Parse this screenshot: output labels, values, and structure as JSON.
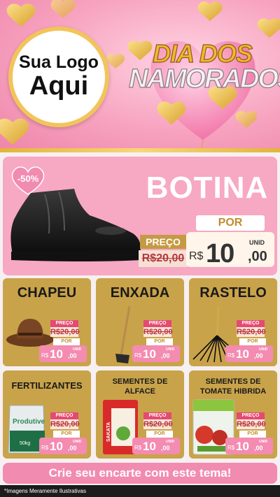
{
  "header": {
    "logo_line1": "Sua Logo",
    "logo_line2": "Aqui",
    "title_line1": "DIA DOS",
    "title_line2": "NAMORADOS",
    "colors": {
      "pink": "#f7a3c0",
      "gold": "#f0b82f"
    }
  },
  "hero": {
    "discount": "-50%",
    "name": "BOTINA",
    "preco_label": "PREÇO",
    "old_price": "R$20,00",
    "por_label": "POR",
    "currency": "R$",
    "price_int": "10",
    "price_dec": ",00",
    "unit": "UNID"
  },
  "products": [
    {
      "name": "CHAPEU",
      "icon": "cowboy-hat-icon",
      "preco_label": "PREÇO",
      "old_price": "R$20,00",
      "por_label": "POR",
      "currency": "R$",
      "price_int": "10",
      "price_dec": ",00",
      "unit": "UNID"
    },
    {
      "name": "ENXADA",
      "icon": "hoe-icon",
      "preco_label": "PREÇO",
      "old_price": "R$20,00",
      "por_label": "POR",
      "currency": "R$",
      "price_int": "10",
      "price_dec": ",00",
      "unit": "UNID"
    },
    {
      "name": "RASTELO",
      "icon": "rake-icon",
      "preco_label": "PREÇO",
      "old_price": "R$20,00",
      "por_label": "POR",
      "currency": "R$",
      "price_int": "10",
      "price_dec": ",00",
      "unit": "UNID"
    },
    {
      "name": "FERTILIZANTES",
      "icon": "fertilizer-bag-icon",
      "preco_label": "PREÇO",
      "old_price": "R$20,00",
      "por_label": "POR",
      "currency": "R$",
      "price_int": "10",
      "price_dec": ",00",
      "unit": "UNID"
    },
    {
      "name": "SEMENTES DE ALFACE",
      "icon": "seed-packet-icon",
      "preco_label": "PREÇO",
      "old_price": "R$20,00",
      "por_label": "POR",
      "currency": "R$",
      "price_int": "10",
      "price_dec": ",00",
      "unit": "UNID"
    },
    {
      "name": "SEMENTES DE TOMATE HIBRIDA",
      "icon": "tomato-seed-packet-icon",
      "preco_label": "PREÇO",
      "old_price": "R$20,00",
      "por_label": "POR",
      "currency": "R$",
      "price_int": "10",
      "price_dec": ",00",
      "unit": "UNID"
    }
  ],
  "product_images": {
    "fertilizer_brand": "Produtive",
    "fertilizer_weight": "50kg",
    "seed_brand": "SAKATA"
  },
  "cta": "Crie seu encarte com este tema!",
  "footer": "*Imagens Meramente Ilustrativas"
}
